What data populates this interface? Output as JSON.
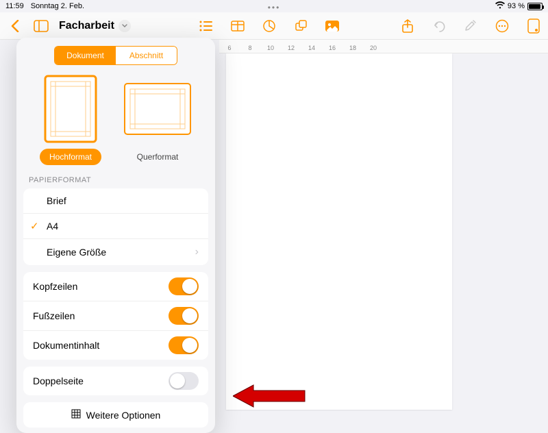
{
  "status": {
    "time": "11:59",
    "date": "Sonntag 2. Feb.",
    "battery_text": "93 %"
  },
  "toolbar": {
    "doc_title": "Facharbeit"
  },
  "ruler": {
    "marks": [
      "6",
      "8",
      "10",
      "12",
      "14",
      "16",
      "18",
      "20"
    ]
  },
  "popover": {
    "segments": {
      "left": "Dokument",
      "right": "Abschnitt"
    },
    "orientation": {
      "portrait": "Hochformat",
      "landscape": "Querformat"
    },
    "paper_header": "PAPIERFORMAT",
    "paper_options": [
      {
        "label": "Brief",
        "checked": false,
        "chevron": false
      },
      {
        "label": "A4",
        "checked": true,
        "chevron": false
      },
      {
        "label": "Eigene Größe",
        "checked": false,
        "chevron": true
      }
    ],
    "toggles": [
      {
        "label": "Kopfzeilen",
        "on": true
      },
      {
        "label": "Fußzeilen",
        "on": true
      },
      {
        "label": "Dokumentinhalt",
        "on": true
      }
    ],
    "double_page": {
      "label": "Doppelseite",
      "on": false
    },
    "more": "Weitere Optionen"
  }
}
